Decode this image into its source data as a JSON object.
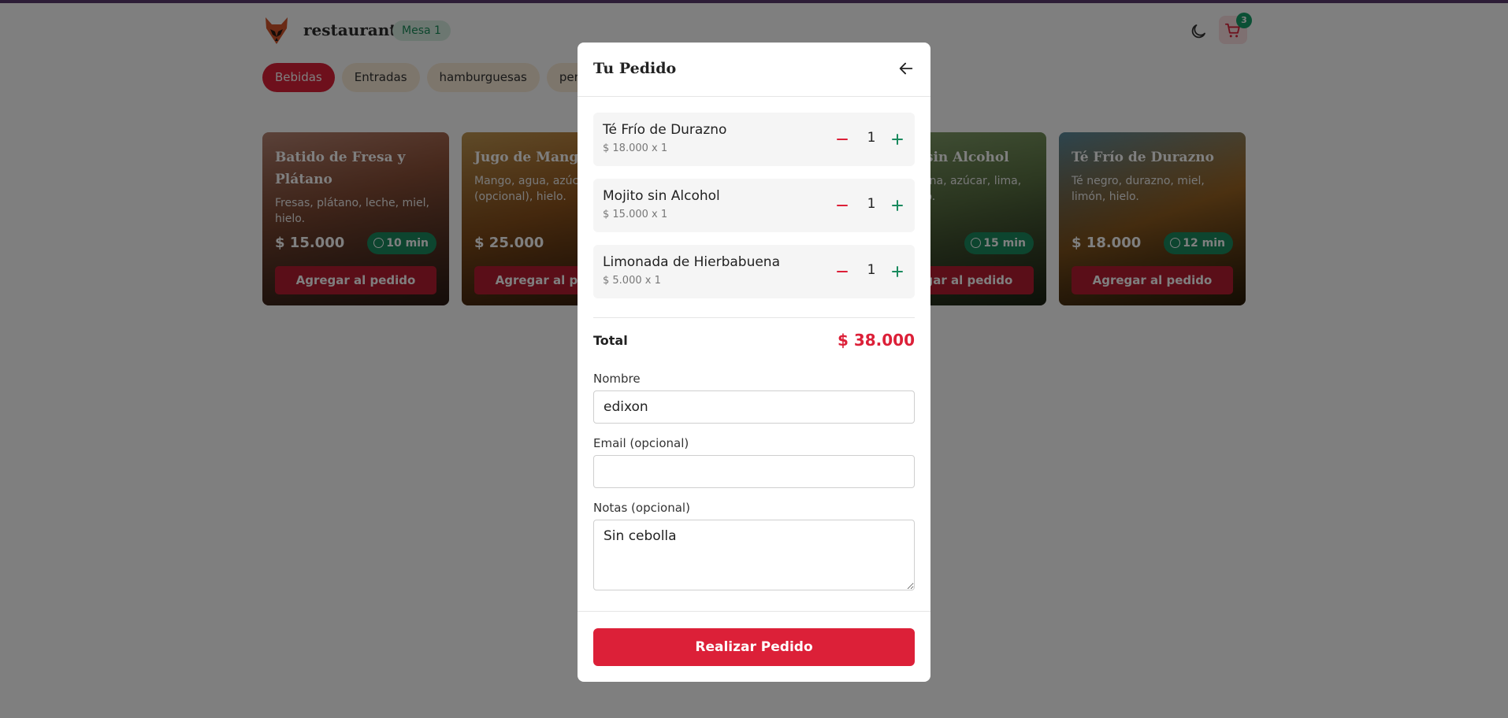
{
  "header": {
    "brand": "restaurant",
    "table_badge": "Mesa 1",
    "cart_count": "3",
    "logo_icon": "fox-logo-icon",
    "theme_icon": "moon-icon",
    "cart_icon": "cart-icon"
  },
  "categories": [
    {
      "label": "Bebidas",
      "active": true
    },
    {
      "label": "Entradas",
      "active": false
    },
    {
      "label": "hamburguesas",
      "active": false
    },
    {
      "label": "perros",
      "active": false
    }
  ],
  "products": [
    {
      "name": "Batido de Fresa y Plátano",
      "desc": "Fresas, plátano, leche, miel, hielo.",
      "price": "$ 15.000",
      "time": "10 min",
      "button": "Agregar al pedido"
    },
    {
      "name": "Jugo de Mango",
      "desc": "Mango, agua, azúcar (opcional), hielo.",
      "price": "$ 25.000",
      "time": "",
      "button": "Agregar al pedido"
    },
    {
      "name": "Mojito sin Alcohol",
      "desc": "Hierbabuena, azúcar, lima, soda, hielo.",
      "price": "",
      "time": "15 min",
      "button": "Agregar al pedido"
    },
    {
      "name": "Té Frío de Durazno",
      "desc": "Té negro, durazno, miel, limón, hielo.",
      "price": "$ 18.000",
      "time": "12 min",
      "button": "Agregar al pedido"
    }
  ],
  "modal": {
    "title": "Tu Pedido",
    "back_icon": "arrow-left-icon",
    "items": [
      {
        "name": "Té Frío de Durazno",
        "sub": "$ 18.000 x 1",
        "qty": "1"
      },
      {
        "name": "Mojito sin Alcohol",
        "sub": "$ 15.000 x 1",
        "qty": "1"
      },
      {
        "name": "Limonada de Hierbabuena",
        "sub": "$ 5.000 x 1",
        "qty": "1"
      }
    ],
    "total_label": "Total",
    "total_value": "$ 38.000",
    "name_label": "Nombre",
    "name_value": "edixon",
    "email_label": "Email (opcional)",
    "email_value": "",
    "notes_label": "Notas (opcional)",
    "notes_value": "Sin cebolla",
    "submit_label": "Realizar Pedido"
  },
  "colors": {
    "accent": "#dc2038",
    "success": "#1a8a5e",
    "header_bar": "#5b3a6e"
  }
}
